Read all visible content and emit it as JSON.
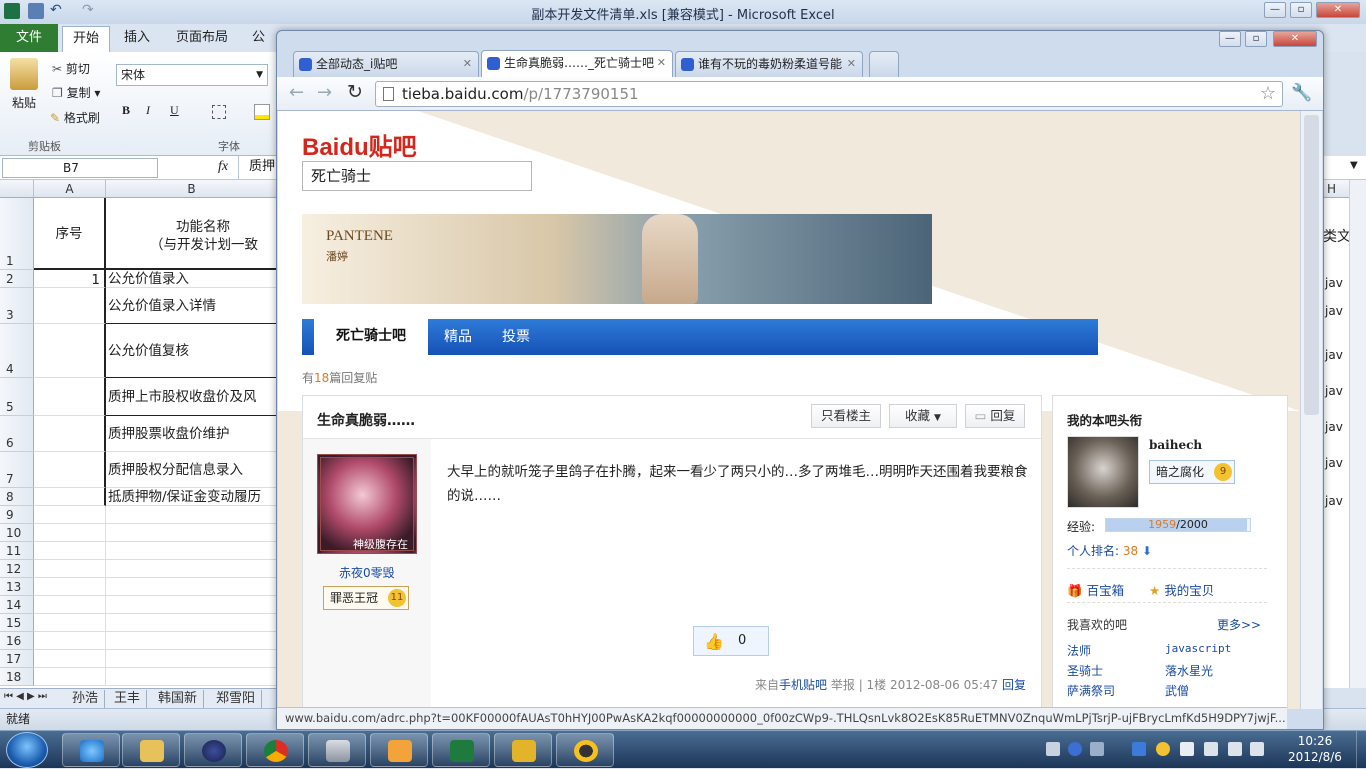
{
  "excel": {
    "title": "副本开发文件清单.xls  [兼容模式] - Microsoft Excel",
    "tabs": [
      "文件",
      "开始",
      "插入",
      "页面布局",
      "公"
    ],
    "clipboard": {
      "paste": "粘贴",
      "cut": "剪切",
      "copy": "复制",
      "format_painter": "格式刷",
      "group": "剪贴板"
    },
    "font": {
      "name": "宋体",
      "bold": "B",
      "italic": "I",
      "underline": "U",
      "group": "字体"
    },
    "name_box": "B7",
    "fx": "fx",
    "formula": "质押",
    "columns": [
      "A",
      "B"
    ],
    "right_col_header": "H",
    "header_row": {
      "seq": "序号",
      "func_line1": "功能名称",
      "func_line2": "（与开发计划一致"
    },
    "rows": [
      {
        "n": "2",
        "a": "1",
        "b": "公允价值录入"
      },
      {
        "n": "3",
        "a": "",
        "b": "公允价值录入详情"
      },
      {
        "n": "4",
        "a": "",
        "b": "公允价值复核"
      },
      {
        "n": "5",
        "a": "",
        "b": "质押上市股权收盘价及风"
      },
      {
        "n": "6",
        "a": "",
        "b": "质押股票收盘价维护"
      },
      {
        "n": "7",
        "a": "",
        "b": "质押股权分配信息录入"
      },
      {
        "n": "8",
        "a": "",
        "b": "抵质押物/保证金变动履历"
      }
    ],
    "empty_rows": [
      "9",
      "10",
      "11",
      "12",
      "13",
      "14",
      "15",
      "16",
      "17",
      "18"
    ],
    "right_col_values": [
      "类文",
      "jav",
      "jav",
      "jav",
      "jav",
      "jav",
      "jav",
      "jav"
    ],
    "sheets": [
      "孙浩",
      "王丰",
      "韩国新",
      "郑雪阳"
    ],
    "status": "就绪"
  },
  "chrome": {
    "tabs": [
      {
        "label": "全部动态_i贴吧"
      },
      {
        "label": "生命真脆弱……_死亡骑士吧"
      },
      {
        "label": "谁有不玩的毒奶粉柔道号能"
      }
    ],
    "url_host": "tieba.baidu.com",
    "url_path": "/p/1773790151",
    "status_url": "www.baidu.com/adrc.php?t=00KF00000fAUAsT0hHYJ00PwAsKA2kqf00000000000_0f00zCWp9-.THLQsnLvk8O2EsK85RuETMNV0ZnquWmLPjTsrjP-ujFBrycLmfKd5H9DPY7jwjF..."
  },
  "tieba": {
    "logo_text": "Baidu贴吧",
    "search_value": "死亡骑士",
    "banner_brand": "PANTENE",
    "banner_sub": "潘婷",
    "nav": [
      "死亡骑士吧",
      "精品",
      "投票"
    ],
    "reply_count_prefix": "有",
    "reply_count": "18",
    "reply_count_suffix": "篇回复贴",
    "post_title": "生命真脆弱……",
    "only_author": "只看楼主",
    "collect": "收藏",
    "reply": "回复",
    "avatar_caption": "神级腹存在",
    "author": "赤夜0零毁",
    "author_badge": "罪恶王冠",
    "author_level": "11",
    "content": "大早上的就听笼子里鸽子在扑腾，起来一看少了两只小的…多了两堆毛…明明昨天还围着我要粮食的说……",
    "like_count": "0",
    "footer_from": "来自",
    "footer_client": "手机贴吧",
    "footer_report": "举报",
    "footer_floor": "1楼",
    "footer_time": "2012-08-06 05:47",
    "footer_reply": "回复",
    "side": {
      "title": "我的本吧头衔",
      "user": "baihech",
      "badge": "暗之腐化",
      "level": "9",
      "exp_label": "经验:",
      "exp_value": "1959",
      "exp_total": "/2000",
      "exp_fraction": 0.98,
      "rank_label": "个人排名:",
      "rank_value": "38",
      "treasure": "百宝箱",
      "my_items": "我的宝贝",
      "fav_title": "我喜欢的吧",
      "more": "更多>>",
      "favs": [
        "法师",
        "javascript",
        "圣骑士",
        "落水星光",
        "萨满祭司",
        "武僧"
      ]
    }
  },
  "taskbar": {
    "time": "10:26",
    "date": "2012/8/6"
  }
}
